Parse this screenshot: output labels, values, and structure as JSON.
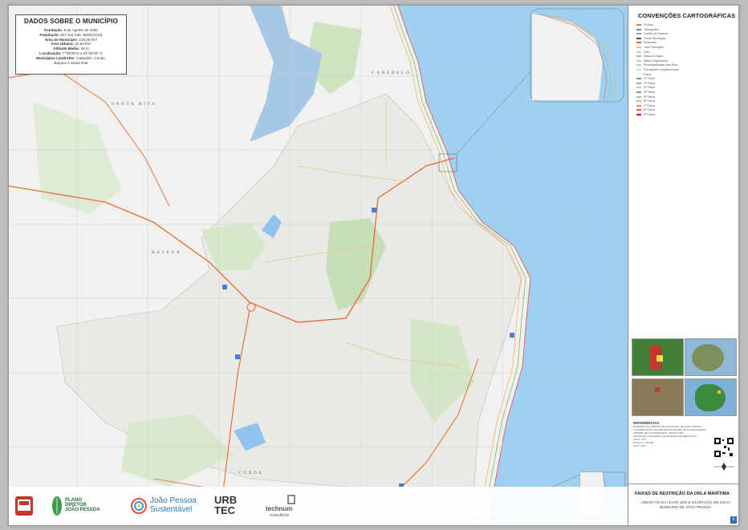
{
  "info_box": {
    "title": "DADOS SOBRE O MUNICÍPIO",
    "lines": [
      {
        "label": "Fundação:",
        "value": "5 de Agosto de 1585"
      },
      {
        "label": "População:",
        "value": "817.511 hab. IBGE(2010)"
      },
      {
        "label": "Área do Município:",
        "value": "210,45 km²"
      },
      {
        "label": "Área Urbana:",
        "value": "32,62 km²"
      },
      {
        "label": "Altitude Média:",
        "value": "40 m"
      },
      {
        "label": "Localização:",
        "value": "7°05'00\"S e 34°50'00\" O"
      },
      {
        "label": "Municípios Limítrofes:",
        "value": "Cabedelo, Conde,"
      },
      {
        "label": "",
        "value": "Bayeux e Santa Rita"
      }
    ]
  },
  "places": {
    "santa_rita": "SANTA RITA",
    "cabedelo": "CABEDELO",
    "bayeux": "BAYEUX",
    "conde": "CONDE"
  },
  "legend": {
    "title": "CONVENÇÕES CARTOGRÁFICAS",
    "items": [
      {
        "label": "Pontos",
        "color": "#e67b2e"
      },
      {
        "label": "Hidrografia",
        "color": "#4a8fd8"
      },
      {
        "label": "Limites de Bairros",
        "color": "#999999"
      },
      {
        "label": "Limite Municipal",
        "color": "#555555"
      },
      {
        "label": "Rodovias",
        "color": "#e0662a"
      },
      {
        "label": "Vias Principais",
        "color": "#f3c27a"
      },
      {
        "label": "Vias",
        "color": "#cccccc"
      },
      {
        "label": "Massa D'água",
        "color": "#7fc3ee"
      },
      {
        "label": "Mata (Vegetação)",
        "color": "#b5d6a6"
      },
      {
        "label": "Permeabilidade dos Rios",
        "color": "#a7c7e6"
      },
      {
        "label": "Formações Vegetacionais",
        "color": "#c9e1b9"
      },
      {
        "label": "Faixa",
        "color": "#ffffff"
      },
      {
        "label": "1ª Faixa",
        "color": "#6aa84f"
      },
      {
        "label": "2ª Faixa",
        "color": "#93c47d"
      },
      {
        "label": "3ª Faixa",
        "color": "#b6d7a8"
      },
      {
        "label": "4ª Faixa",
        "color": "#c27ba0"
      },
      {
        "label": "5ª Faixa",
        "color": "#a2c4c9"
      },
      {
        "label": "6ª Faixa",
        "color": "#f6b26b"
      },
      {
        "label": "7ª Faixa",
        "color": "#e69138"
      },
      {
        "label": "8ª Faixa",
        "color": "#e06666"
      },
      {
        "label": "9ª Faixa",
        "color": "#cc0000"
      }
    ]
  },
  "references": {
    "title": "REFERÊNCIAS",
    "lines": [
      "ELABORAÇÃO: PREFEITURA MUNICIPAL DE JOÃO PESSOA",
      "COORDENAÇÃO: SECRETARIA MUNICIPAL DE PLANEJAMENTO",
      "SISTEMA DE COORDENADAS: SIRGAS 2000",
      "PROJEÇÃO: UNIVERSAL TRANSVERSA DE MERCATOR",
      "FUSO: 25 S",
      "ESCALA: 1:25.000",
      "DATA: 2021"
    ]
  },
  "title_block": {
    "main": "FAIXAS DE RESTRIÇÃO DA ORLA MARÍTIMA",
    "sub": "ANEXO VIII DA LEI DE USO E OCUPAÇÃO DO SOLO MUNICÍPIO DE JOÃO PESSOA",
    "sheet": "0"
  },
  "logos": {
    "plano_diretor": [
      "PLANO",
      "DIRETOR",
      "JOÃO PESSOA"
    ],
    "joao_pessoa_sustentavel": [
      "João Pessoa",
      "Sustentável"
    ],
    "urbtec": "URB TEC",
    "technum": [
      "technum",
      "consultoria"
    ]
  },
  "colors": {
    "sea": "#9fd0f2",
    "urban": "#e9e9e6",
    "green": "#cfe3c1",
    "highway": "#e8692c"
  }
}
